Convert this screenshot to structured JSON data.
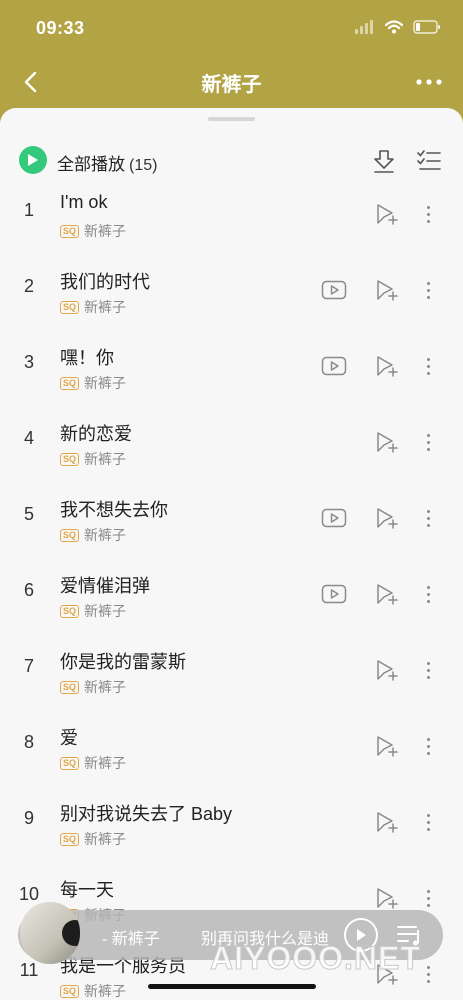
{
  "status_bar": {
    "time": "09:33"
  },
  "nav": {
    "title": "新裤子"
  },
  "play_all": {
    "label": "全部播放",
    "count": "(15)"
  },
  "songs": [
    {
      "index": "1",
      "title": "I'm ok",
      "badge": "SQ",
      "artist": "新裤子",
      "has_mv": false
    },
    {
      "index": "2",
      "title": "我们的时代",
      "badge": "SQ",
      "artist": "新裤子",
      "has_mv": true
    },
    {
      "index": "3",
      "title": "嘿！你",
      "badge": "SQ",
      "artist": "新裤子",
      "has_mv": true
    },
    {
      "index": "4",
      "title": "新的恋爱",
      "badge": "SQ",
      "artist": "新裤子",
      "has_mv": false
    },
    {
      "index": "5",
      "title": "我不想失去你",
      "badge": "SQ",
      "artist": "新裤子",
      "has_mv": true
    },
    {
      "index": "6",
      "title": "爱情催泪弹",
      "badge": "SQ",
      "artist": "新裤子",
      "has_mv": true
    },
    {
      "index": "7",
      "title": "你是我的雷蒙斯",
      "badge": "SQ",
      "artist": "新裤子",
      "has_mv": false
    },
    {
      "index": "8",
      "title": "爱",
      "badge": "SQ",
      "artist": "新裤子",
      "has_mv": false
    },
    {
      "index": "9",
      "title": "别对我说失去了 Baby",
      "badge": "SQ",
      "artist": "新裤子",
      "has_mv": false
    },
    {
      "index": "10",
      "title": "每一天",
      "badge": "SQ",
      "artist": "新裤子",
      "has_mv": false
    },
    {
      "index": "11",
      "title": "我是一个服务员",
      "badge": "SQ",
      "artist": "新裤子",
      "has_mv": false
    }
  ],
  "mini_player": {
    "artist": "- 新裤子",
    "lyric": "别再问我什么是迪"
  },
  "watermark": "AIYOOO.NET",
  "colors": {
    "header_bg": "#b2a445",
    "accent_green": "#35c97b",
    "sq_badge": "#e0a84a"
  }
}
